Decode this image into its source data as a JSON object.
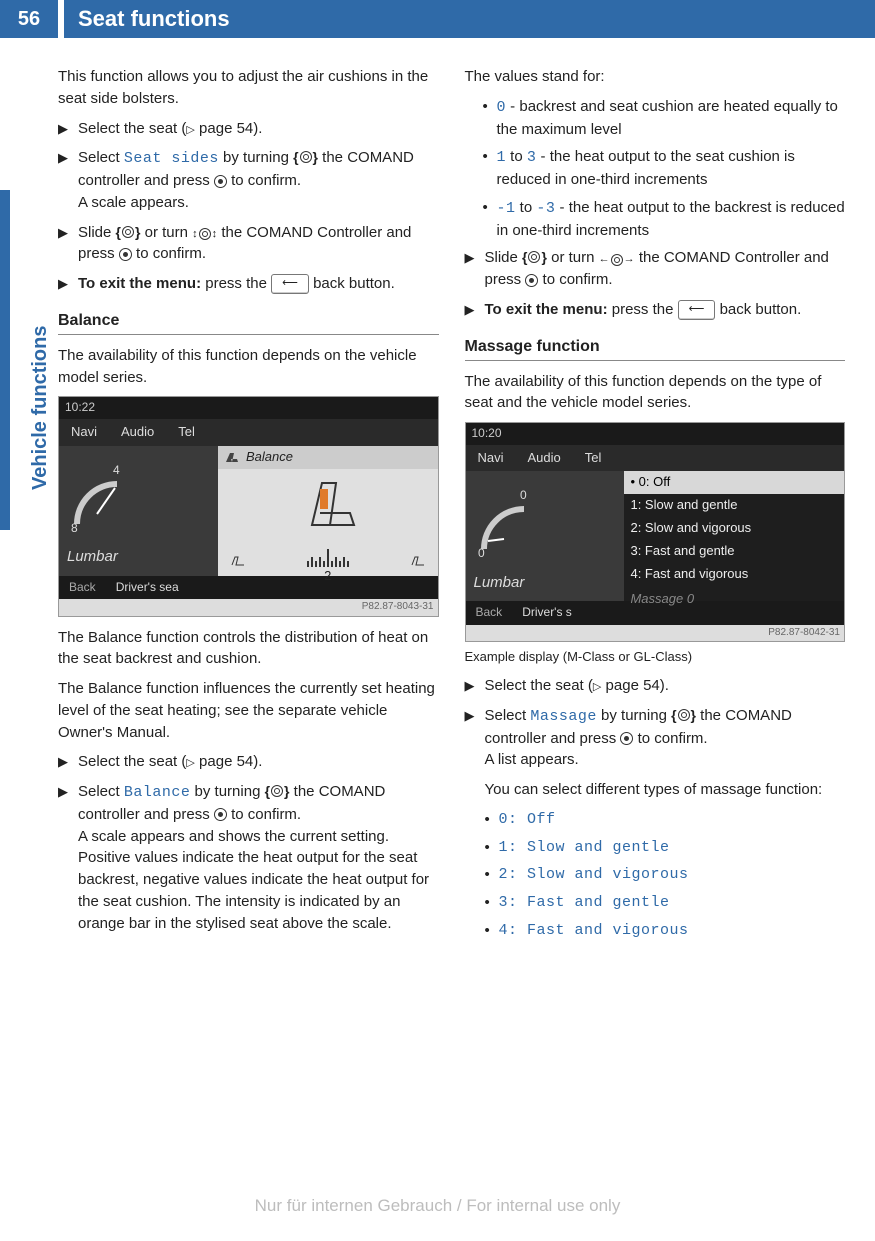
{
  "page_number": "56",
  "header_title": "Seat functions",
  "side_tab": "Vehicle functions",
  "col1": {
    "intro": "This function allows you to adjust the air cushions in the seat side bolsters.",
    "step1_a": "Select the seat (",
    "step1_b": " page 54).",
    "step2_a": "Select ",
    "step2_code": "Seat sides",
    "step2_b": " by turning ",
    "step2_c": " the COMAND controller and press ",
    "step2_d": " to confirm.",
    "step2_e": "A scale appears.",
    "step3_a": "Slide ",
    "step3_b": " or turn ",
    "step3_c": " the COMAND Controller and press ",
    "step3_d": " to confirm.",
    "step4_bold": "To exit the menu:",
    "step4_a": " press the ",
    "step4_b": " back button.",
    "balance_heading": "Balance",
    "balance_p1": "The availability of this function depends on the vehicle model series.",
    "ss1": {
      "time": "10:22",
      "tabs": [
        "Navi",
        "Audio",
        "Tel"
      ],
      "panel_title": "Balance",
      "gauge_top": "4",
      "gauge_bottom": "8",
      "lumbar": "Lumbar",
      "back": "Back",
      "driver": "Driver's sea",
      "scale_label": "2",
      "code": "P82.87-8043-31"
    },
    "balance_p2": "The Balance function controls the distribution of heat on the seat backrest and cushion.",
    "balance_p3": "The Balance function influences the currently set heating level of the seat heating; see the separate vehicle Owner's Manual.",
    "bstep1_a": "Select the seat (",
    "bstep1_b": " page 54).",
    "bstep2_a": "Select ",
    "bstep2_code": "Balance",
    "bstep2_b": " by turning ",
    "bstep2_c": " the COMAND controller and press ",
    "bstep2_d": " to confirm.",
    "bstep2_e": "A scale appears and shows the current setting. Positive values indicate the heat output for the seat backrest, negative values indicate the heat output for the seat cushion. The intensity is indicated by an orange bar in the stylised seat above the scale."
  },
  "col2": {
    "values_intro": "The values stand for:",
    "v1_code": "0",
    "v1_txt": " - backrest and seat cushion are heated equally to the maximum level",
    "v2_code_a": "1",
    "v2_mid": " to ",
    "v2_code_b": "3",
    "v2_txt": " - the heat output to the seat cushion is reduced in one-third increments",
    "v3_code_a": "-1",
    "v3_mid": " to ",
    "v3_code_b": "-3",
    "v3_txt": " - the heat output to the backrest is reduced in one-third increments",
    "step1_a": "Slide ",
    "step1_b": " or turn ",
    "step1_c": " the COMAND Controller and press ",
    "step1_d": " to confirm.",
    "step2_bold": "To exit the menu:",
    "step2_a": " press the ",
    "step2_b": " back button.",
    "massage_heading": "Massage function",
    "massage_p1": "The availability of this function depends on the type of seat and the vehicle model series.",
    "ss2": {
      "time": "10:20",
      "tabs": [
        "Navi",
        "Audio",
        "Tel"
      ],
      "list": [
        "0: Off",
        "1: Slow and gentle",
        "2: Slow and vigorous",
        "3: Fast and gentle",
        "4: Fast and vigorous"
      ],
      "gauge_top": "0",
      "gauge_bottom": "0",
      "lumbar": "Lumbar",
      "back": "Back",
      "driver": "Driver's s",
      "massage_label": "Massage  0",
      "code": "P82.87-8042-31"
    },
    "ss2_caption": "Example display (M-Class or GL-Class)",
    "mstep1_a": "Select the seat (",
    "mstep1_b": " page 54).",
    "mstep2_a": "Select ",
    "mstep2_code": "Massage",
    "mstep2_b": " by turning ",
    "mstep2_c": " the COMAND controller and press ",
    "mstep2_d": " to confirm.",
    "mstep2_e": "A list appears.",
    "mstep2_f": "You can select different types of massage function:",
    "opts": [
      "0: Off",
      "1: Slow and gentle",
      "2: Slow and vigorous",
      "3: Fast and gentle",
      "4: Fast and vigorous"
    ]
  },
  "watermark": "Nur für internen Gebrauch / For internal use only",
  "back_glyph": "⟵"
}
